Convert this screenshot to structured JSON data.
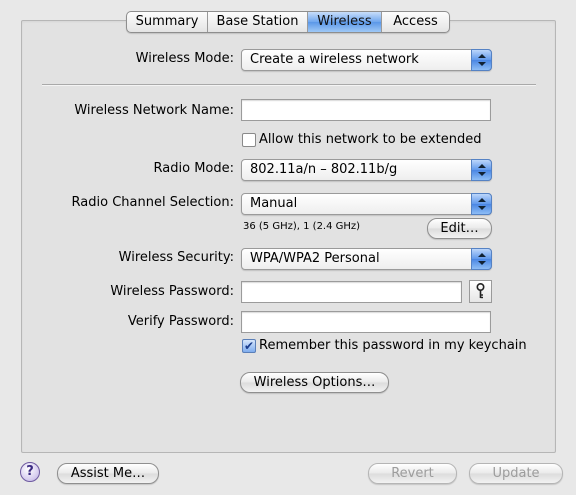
{
  "tabs": [
    "Summary",
    "Base Station",
    "Wireless",
    "Access"
  ],
  "selected_tab": "Wireless",
  "wireless_mode": {
    "label": "Wireless Mode:",
    "value": "Create a wireless network"
  },
  "network_name": {
    "label": "Wireless Network Name:",
    "value": ""
  },
  "allow_extended": {
    "label": "Allow this network to be extended",
    "checked": false
  },
  "radio_mode": {
    "label": "Radio Mode:",
    "value": "802.11a/n – 802.11b/g"
  },
  "channel": {
    "label": "Radio Channel Selection:",
    "value": "Manual",
    "info": "36 (5 GHz), 1 (2.4 GHz)",
    "edit_label": "Edit…"
  },
  "security": {
    "label": "Wireless Security:",
    "value": "WPA/WPA2 Personal"
  },
  "password": {
    "label": "Wireless Password:",
    "value": ""
  },
  "verify": {
    "label": "Verify Password:",
    "value": ""
  },
  "remember": {
    "label": "Remember this password in my keychain",
    "checked": true
  },
  "options_button": "Wireless Options…",
  "footer": {
    "help": "?",
    "assist": "Assist Me…",
    "revert": "Revert",
    "update": "Update"
  }
}
